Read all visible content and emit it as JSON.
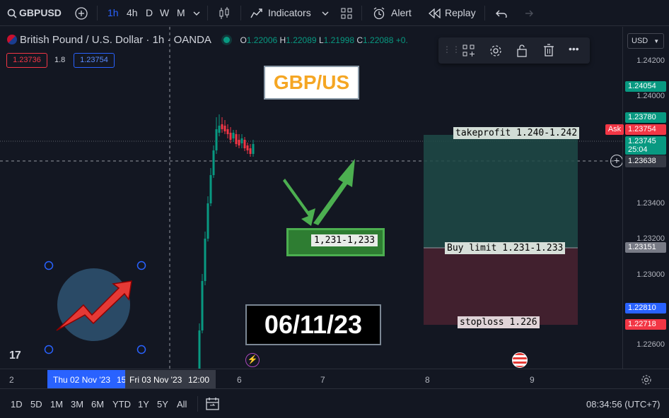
{
  "toolbar": {
    "symbol": "GBPUSD",
    "intervals": [
      "1h",
      "4h",
      "D",
      "W",
      "M"
    ],
    "indicators": "Indicators",
    "alert": "Alert",
    "replay": "Replay"
  },
  "legend": {
    "title": "British Pound / U.S. Dollar · 1h · OANDA",
    "o_label": "O",
    "o_value": "1.22006",
    "h_label": "H",
    "h_value": "1.22089",
    "l_label": "L",
    "l_value": "1.21998",
    "c_label": "C",
    "c_value": "1.22088",
    "change": "+0.",
    "bid": "1.23736",
    "spread": "1.8",
    "ask": "1.23754"
  },
  "price_axis": {
    "currency": "USD",
    "ticks": [
      "1.24200",
      "1.24000",
      "1.23400",
      "1.23200",
      "1.23000",
      "1.22600"
    ],
    "badges": {
      "b1": "1.24054",
      "b2": "1.23780",
      "ask_tag": "Ask",
      "b3": "1.23754",
      "b4": "1.23745",
      "b4_timer": "25:04",
      "crosshair": "1.23638",
      "b5": "1.23151",
      "b6": "1.22810",
      "b7": "1.22718"
    }
  },
  "annotations": {
    "title": "GBP/US",
    "date": "06/11/23",
    "zone": "1,231-1,233",
    "takeprofit": "takeprofit 1.240-1.242",
    "buylimit": "Buy limit 1.231-1.233",
    "stoploss": "stoploss 1.226"
  },
  "time_axis": {
    "t0": "2",
    "t1": "Thu 02 Nov '23",
    "t1b": "15",
    "t2": "Fri 03 Nov '23",
    "t3": "12:00",
    "t4": "6",
    "t5": "7",
    "t6": "8",
    "t7": "9"
  },
  "bottom": {
    "ranges": [
      "1D",
      "5D",
      "1M",
      "3M",
      "6M",
      "YTD",
      "1Y",
      "5Y",
      "All"
    ],
    "clock": "08:34:56 (UTC+7)"
  },
  "colors": {
    "up": "#089981",
    "down": "#f23645",
    "accent": "#2962ff"
  }
}
